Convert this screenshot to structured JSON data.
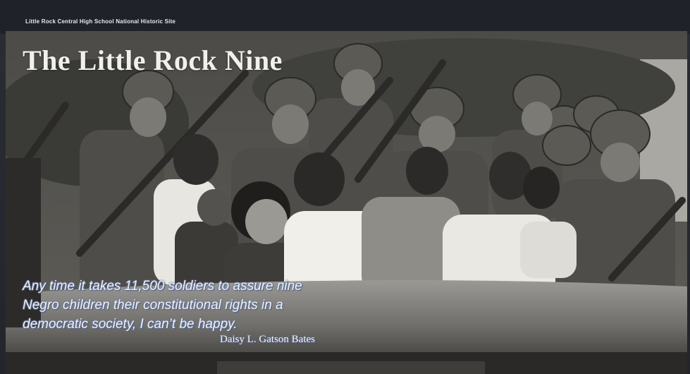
{
  "header": {
    "site_name": "Little Rock Central High School National Historic Site"
  },
  "title": "The Little Rock Nine",
  "quote": {
    "lines": [
      "Any time it takes 11,500 soldiers to assure nine",
      "Negro children their constitutional rights in a",
      "democratic society, I can’t be happy."
    ],
    "attribution": "Daisy L. Gatson Bates"
  },
  "colors": {
    "background": "#23252b",
    "title_text": "#f1f0ec",
    "quote_glow": "#6d7fa8"
  }
}
